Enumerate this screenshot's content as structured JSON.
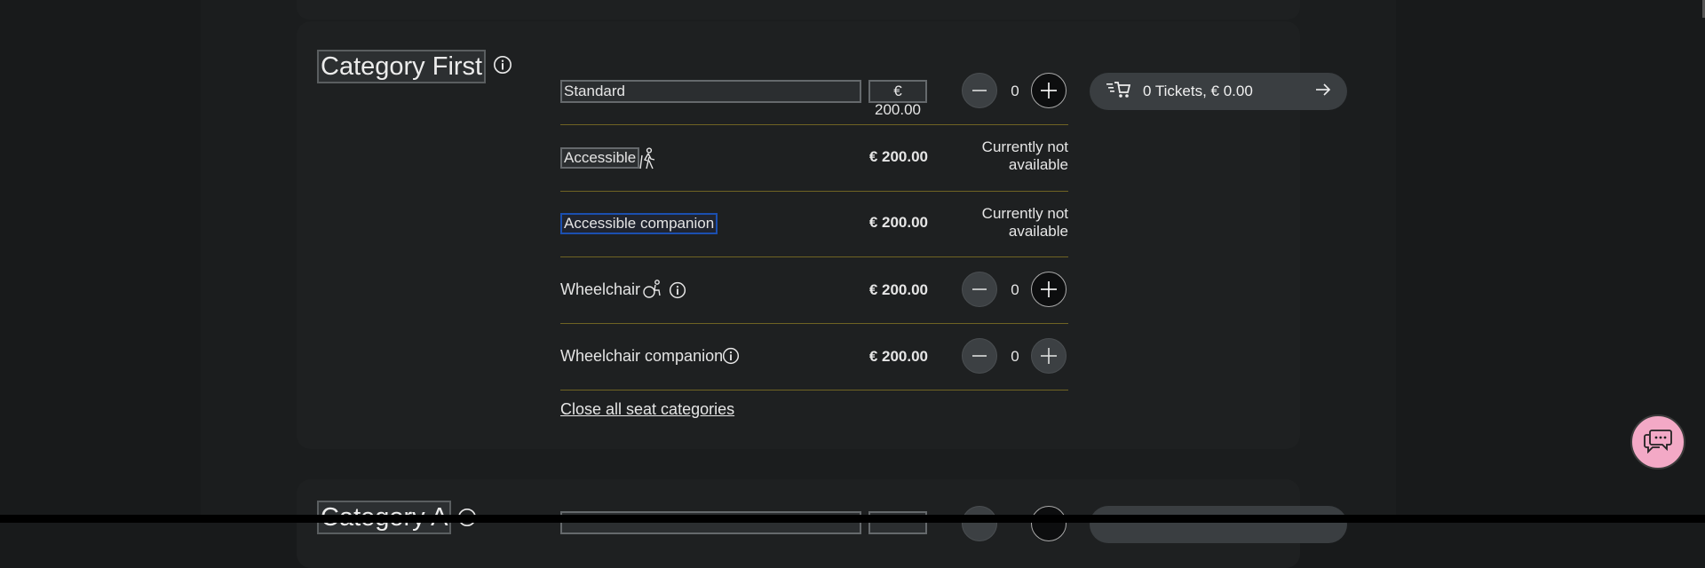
{
  "colors": {
    "background": "#181a1b",
    "card": "#1e2021",
    "divider": "#6f6323",
    "chat": "#f3a9c6"
  },
  "category_first": {
    "title": "Category First",
    "standard_select": "Standard",
    "standard_price": "€ 200.00",
    "standard_qty": "0",
    "cart_label": "0 Tickets, € 0.00",
    "rows": [
      {
        "label": "Accessible",
        "price": "€ 200.00",
        "status": "Currently not available",
        "icon": "accessible-blind-icon"
      },
      {
        "label": "Accessible companion",
        "price": "€ 200.00",
        "status": "Currently not available"
      },
      {
        "label": "Wheelchair",
        "price": "€ 200.00",
        "qty": "0",
        "icon": "wheelchair-icon"
      },
      {
        "label": "Wheelchair companion",
        "price": "€ 200.00",
        "qty": "0"
      }
    ],
    "close_link": "Close all seat categories"
  },
  "category_a": {
    "title": "Category A"
  }
}
